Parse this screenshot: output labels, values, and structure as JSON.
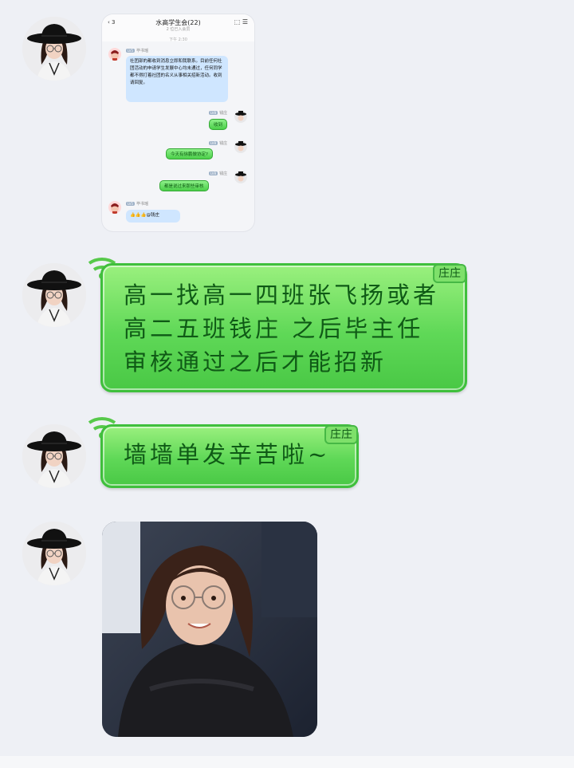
{
  "embedded_chat": {
    "title": "水高学生会(22)",
    "subtitle": "2 位已入会员",
    "time": "下午 2:30",
    "back_count": "3",
    "announce_name": "毕书瑶",
    "announce_level": "LV5",
    "announce_text": "社团部的都收到消息立即和我联系。目前任何社团活动的申请学生发展中心均未通过，任何同学都不得打着社团的名义从事相关招新活动。收到请回复。",
    "reply1_name": "钱庄",
    "reply1_level": "LV8",
    "reply1_text": "收到",
    "reply2_name": "钱庄",
    "reply2_level": "LV8",
    "reply2_text": "今天有徐鹏做协定?",
    "reply3_name": "钱庄",
    "reply3_level": "LV8",
    "reply3_text": "都是说过来那些审核",
    "last_name": "毕书瑶",
    "last_level": "LV5",
    "last_text": "👍👍👍@钱庄"
  },
  "messages": [
    {
      "tag": "庄庄",
      "lines": [
        "高一找高一四班张飞扬或者",
        "高二五班钱庄 之后毕主任",
        "审核通过之后才能招新"
      ]
    },
    {
      "tag": "庄庄",
      "lines": [
        "墙墙单发辛苦啦~"
      ]
    }
  ],
  "colors": {
    "background": "#eef0f5",
    "bubble_green": "#5fd857",
    "bubble_text": "#0f5a16"
  }
}
